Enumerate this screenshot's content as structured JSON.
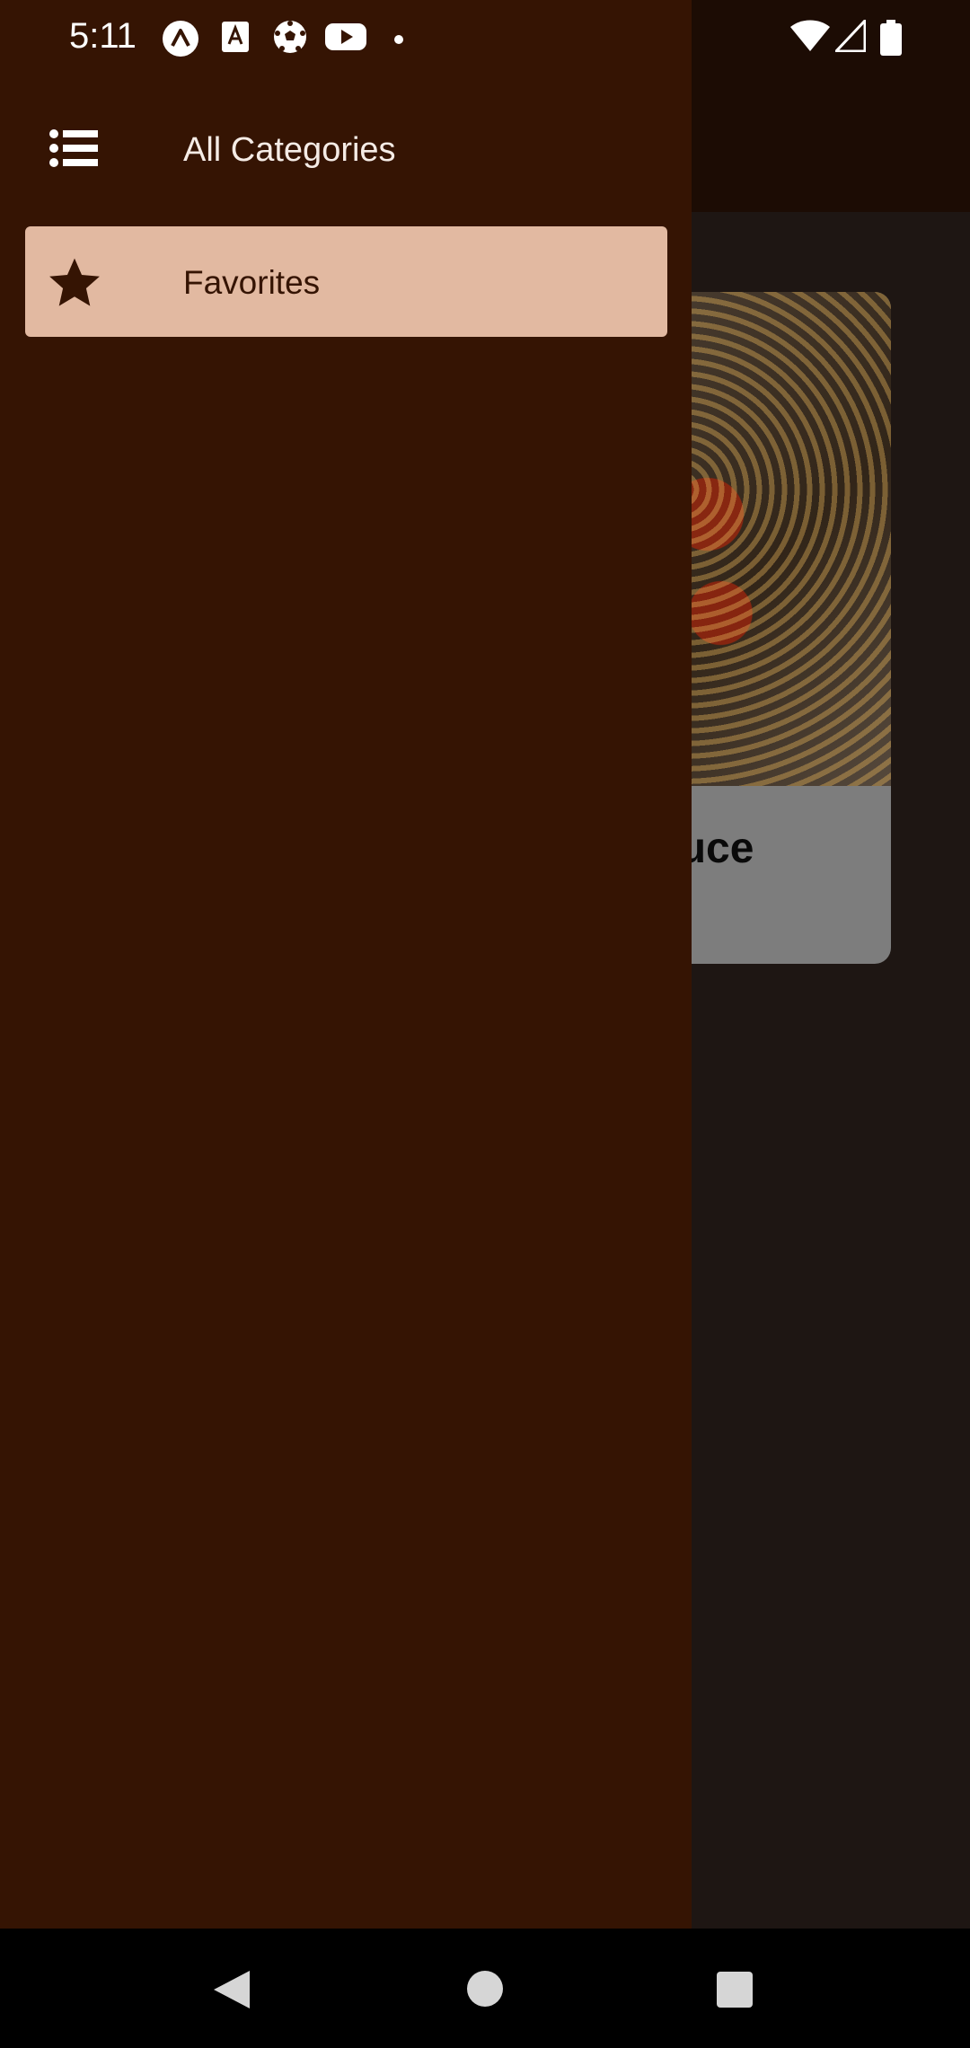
{
  "status_bar": {
    "time": "5:11",
    "notification_icons": [
      "expo-icon",
      "font-download-icon",
      "soccer-ball-icon",
      "youtube-icon",
      "dot-icon"
    ],
    "system_icons": [
      "wifi-icon",
      "cellular-signal-icon",
      "battery-icon"
    ]
  },
  "drawer": {
    "header_icon": "list-icon",
    "header_title": "All Categories",
    "items": [
      {
        "label": "Favorites",
        "icon": "star-icon",
        "selected": true
      }
    ]
  },
  "background_screen": {
    "visible_meal_title_fragment": "auce"
  },
  "nav_bar": {
    "buttons": [
      "back-icon",
      "home-icon",
      "recents-icon"
    ]
  },
  "colors": {
    "drawer_bg": "#351403",
    "selected_item_bg": "#e2b9a1",
    "selected_item_text": "#351403",
    "header_text": "#f5ece6"
  }
}
